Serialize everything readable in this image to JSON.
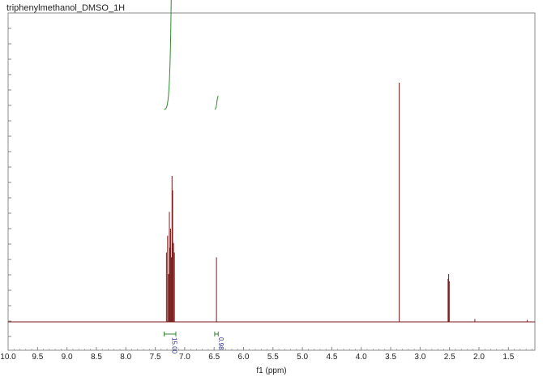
{
  "title": "triphenylmethanol_DMSO_1H",
  "colors": {
    "spectrum": "#7a1a1a",
    "integral": "#2d8a2d",
    "integral_label": "#2b2b8a",
    "frame": "#8a8a8a"
  },
  "chart_data": {
    "type": "line",
    "title": "triphenylmethanol_DMSO_1H",
    "xlabel": "f1 (ppm)",
    "ylabel": "",
    "x_reversed": true,
    "xlim": [
      10.0,
      1.05
    ],
    "ylim": [
      0,
      1.0
    ],
    "grid": false,
    "x_ticks": [
      {
        "value": 10.0,
        "label": "10.0"
      },
      {
        "value": 9.5,
        "label": "9.5"
      },
      {
        "value": 9.0,
        "label": "9.0"
      },
      {
        "value": 8.5,
        "label": "8.5"
      },
      {
        "value": 8.0,
        "label": "8.0"
      },
      {
        "value": 7.5,
        "label": "7.5"
      },
      {
        "value": 7.0,
        "label": "7.0"
      },
      {
        "value": 6.5,
        "label": "6.5"
      },
      {
        "value": 6.0,
        "label": "6.0"
      },
      {
        "value": 5.5,
        "label": "5.5"
      },
      {
        "value": 5.0,
        "label": "5.0"
      },
      {
        "value": 4.5,
        "label": "4.5"
      },
      {
        "value": 4.0,
        "label": "4.0"
      },
      {
        "value": 3.5,
        "label": "3.5"
      },
      {
        "value": 3.0,
        "label": "3.0"
      },
      {
        "value": 2.5,
        "label": "2.5"
      },
      {
        "value": 2.0,
        "label": "2.0"
      },
      {
        "value": 1.5,
        "label": "1.5"
      }
    ],
    "peaks": [
      {
        "ppm": 7.31,
        "height": 0.29
      },
      {
        "ppm": 7.29,
        "height": 0.36
      },
      {
        "ppm": 7.275,
        "height": 0.2
      },
      {
        "ppm": 7.26,
        "height": 0.46
      },
      {
        "ppm": 7.25,
        "height": 0.31
      },
      {
        "ppm": 7.24,
        "height": 0.39
      },
      {
        "ppm": 7.225,
        "height": 0.27
      },
      {
        "ppm": 7.215,
        "height": 0.61
      },
      {
        "ppm": 7.205,
        "height": 0.55
      },
      {
        "ppm": 7.19,
        "height": 0.33
      },
      {
        "ppm": 7.175,
        "height": 0.29
      },
      {
        "ppm": 6.46,
        "height": 0.27
      },
      {
        "ppm": 3.355,
        "height": 1.0
      },
      {
        "ppm": 2.525,
        "height": 0.18
      },
      {
        "ppm": 2.515,
        "height": 0.2
      },
      {
        "ppm": 2.505,
        "height": 0.17
      },
      {
        "ppm": 2.07,
        "height": 0.012
      },
      {
        "ppm": 1.18,
        "height": 0.008
      }
    ],
    "integrals": [
      {
        "from": 7.35,
        "to": 7.15,
        "value": "15.00",
        "curve_rise": 0.28
      },
      {
        "from": 6.49,
        "to": 6.43,
        "value": "0.98",
        "curve_rise": 0.018
      }
    ]
  }
}
